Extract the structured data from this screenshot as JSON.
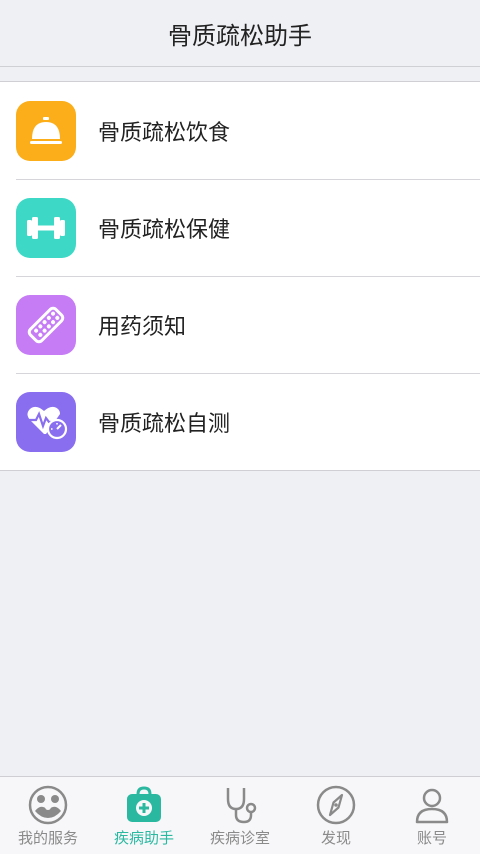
{
  "header": {
    "title": "骨质疏松助手"
  },
  "menu": {
    "items": [
      {
        "label": "骨质疏松饮食",
        "icon": "service-bell-icon",
        "color": "#fbae1a"
      },
      {
        "label": "骨质疏松保健",
        "icon": "dumbbell-icon",
        "color": "#3dd9c6"
      },
      {
        "label": "用药须知",
        "icon": "pill-blister-icon",
        "color": "#c57cf5"
      },
      {
        "label": "骨质疏松自测",
        "icon": "heart-pulse-gauge-icon",
        "color": "#8a6ef0"
      }
    ]
  },
  "tabbar": {
    "active_color": "#2bb8a1",
    "inactive_color": "#8a8a8a",
    "tabs": [
      {
        "label": "我的服务",
        "icon": "family-circle-icon",
        "active": false
      },
      {
        "label": "疾病助手",
        "icon": "medical-kit-icon",
        "active": true
      },
      {
        "label": "疾病诊室",
        "icon": "stethoscope-icon",
        "active": false
      },
      {
        "label": "发现",
        "icon": "compass-icon",
        "active": false
      },
      {
        "label": "账号",
        "icon": "user-icon",
        "active": false
      }
    ]
  }
}
